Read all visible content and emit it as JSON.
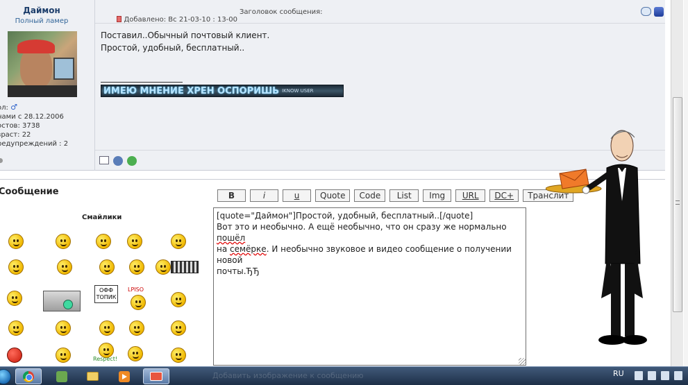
{
  "post": {
    "author": {
      "name": "Даймон",
      "rank": "Полный ламер",
      "stats": [
        {
          "label": "ол:",
          "value": "♂"
        },
        {
          "label": "нами с",
          "value": "28.12.2006"
        },
        {
          "label": "остов:",
          "value": "3738"
        },
        {
          "label": "зраст:",
          "value": "22"
        },
        {
          "label": "редупреждений :",
          "value": "2"
        }
      ]
    },
    "posted_label": "Добавлено: Вс 21-03-10 : 13-00",
    "subject_label": "Заголовок сообщения:",
    "body_lines": [
      "Поставил..Обычный почтовый клиент.",
      "Простой, удобный, бесплатный.."
    ],
    "signature": {
      "text": "ИМЕЮ МНЕНИЕ ХРЕН ОСПОРИШЬ",
      "sub": "IKNOW USER"
    },
    "icons": {
      "header": [
        "quote-icon",
        "edit-icon"
      ],
      "footer": [
        "profile-icon",
        "pm-icon",
        "www-icon"
      ]
    }
  },
  "reply": {
    "message_label": "Сообщение",
    "smilies_label": "Смайлики",
    "smiley_captions": {
      "sign": "ОФФ ТОПИК",
      "lpiso": "LPISO",
      "respect": "Respect!"
    },
    "toolbar": [
      {
        "id": "bold",
        "label": "B"
      },
      {
        "id": "italic",
        "label": "i"
      },
      {
        "id": "underline",
        "label": "u"
      },
      {
        "id": "quote",
        "label": "Quote"
      },
      {
        "id": "code",
        "label": "Code"
      },
      {
        "id": "list",
        "label": "List"
      },
      {
        "id": "img",
        "label": "Img"
      },
      {
        "id": "url",
        "label": "URL"
      },
      {
        "id": "dc",
        "label": "DC+"
      },
      {
        "id": "translit",
        "label": "Транслит"
      }
    ],
    "editor": {
      "line1": "[quote=\"Даймон\"]Простой, удобный, бесплатный..[/quote]",
      "line2_a": "Вот это и необычно. А ещё необычно, что он сразу же нормально ",
      "line2_spell1": "пошёл",
      "line3_a": "на ",
      "line3_spell2": "семёрке",
      "line3_b": ". И необычно звуковое и видео сообщение о получении новой",
      "line4": "почты.ЂЂ"
    }
  },
  "taskbar": {
    "ghost_text": "Добавить изображение к сообщению",
    "language": "RU",
    "apps": [
      "start-orb",
      "chrome-icon",
      "game-icon",
      "explorer-folder-icon",
      "media-player-icon",
      "mail-client-icon"
    ]
  },
  "colors": {
    "post_bg": "#eef0f4",
    "username": "#1d3e6b",
    "taskbar": "#1d2f47"
  }
}
